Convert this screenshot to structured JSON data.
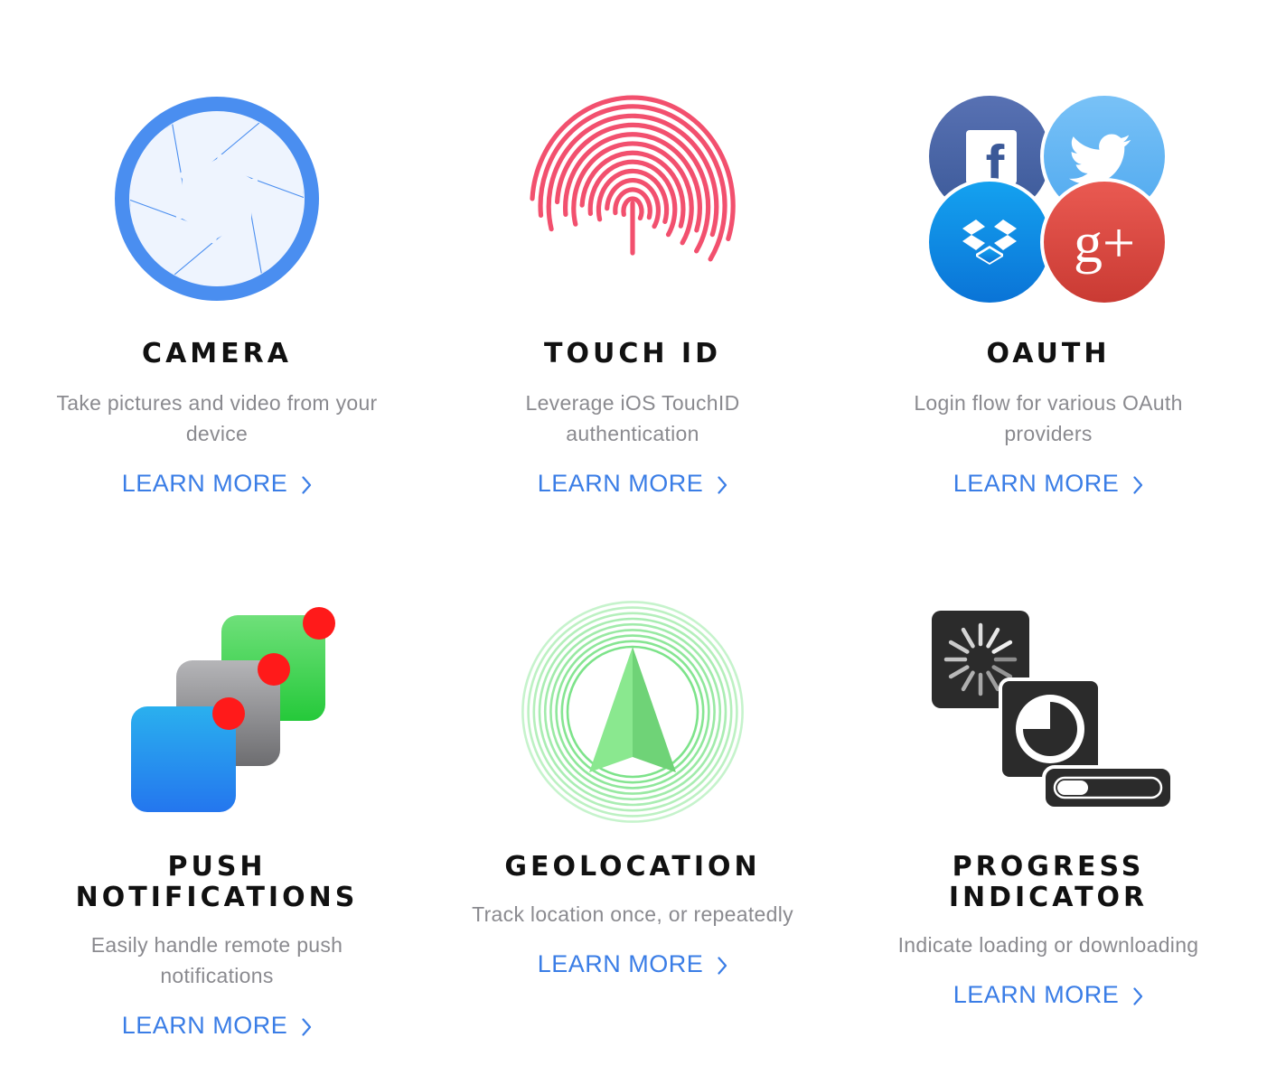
{
  "colors": {
    "title": "#111111",
    "description": "#8a8a8f",
    "link": "#3a7de6",
    "camera_blue": "#4a8ef0",
    "touchid_pink": "#f2506e",
    "facebook": "#3b5998",
    "twitter": "#55acee",
    "dropbox": "#0d8fe0",
    "googleplus": "#dd4b39",
    "push_green": "#4cd964",
    "push_gray": "#8e8e93",
    "push_blue": "#2f8ff0",
    "badge_red": "#ff1a1a",
    "geo_green": "#7de38a",
    "progress_dark": "#2b2b2b"
  },
  "features": [
    {
      "icon": "camera-aperture-icon",
      "title": "CAMERA",
      "description": "Take pictures and video from your device",
      "link": "LEARN MORE"
    },
    {
      "icon": "fingerprint-icon",
      "title": "TOUCH ID",
      "description": "Leverage iOS TouchID authentication",
      "link": "LEARN MORE"
    },
    {
      "icon": "oauth-providers-icon",
      "title": "OAUTH",
      "description": "Login flow for various OAuth providers",
      "link": "LEARN MORE",
      "providers": {
        "facebook": "f",
        "googleplus": "g+"
      }
    },
    {
      "icon": "push-notifications-icon",
      "title_lines": [
        "PUSH",
        "NOTIFICATIONS"
      ],
      "description": "Easily handle remote push notifications",
      "link": "LEARN MORE"
    },
    {
      "icon": "geolocation-arrow-icon",
      "title": "GEOLOCATION",
      "description": "Track location once, or repeatedly",
      "link": "LEARN MORE"
    },
    {
      "icon": "progress-indicator-icon",
      "title_lines": [
        "PROGRESS",
        "INDICATOR"
      ],
      "description": "Indicate loading or downloading",
      "link": "LEARN MORE"
    }
  ]
}
